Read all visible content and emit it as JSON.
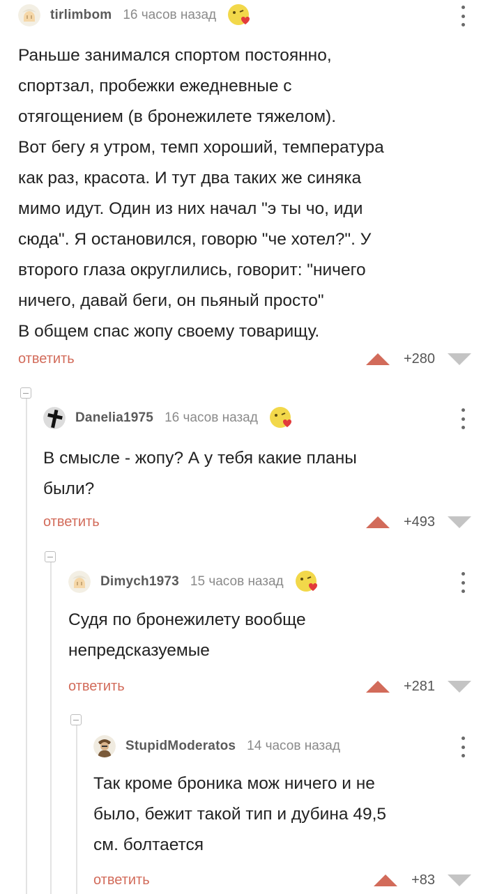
{
  "comments": [
    {
      "author": "tirlimbom",
      "time": "16 часов назад",
      "text": "Раньше занимался спортом постоянно,\nспортзал, пробежки ежедневные с\nотягощением (в бронежилете тяжелом).\nВот бегу я утром, темп хороший, температура\nкак раз, красота. И тут два таких же синяка\nмимо идут. Один из них начал \"э ты чо, иди\nсюда\". Я остановился, говорю \"че хотел?\". У\nвторого глаза округлились, говорит: \"ничего\nничего, давай беги, он пьяный просто\"\nВ общем спас жопу своему товарищу.",
      "reply": "ответить",
      "rating": "+280"
    },
    {
      "author": "Danelia1975",
      "time": "16 часов назад",
      "text": "В смысле - жопу? А у тебя какие планы\nбыли?",
      "reply": "ответить",
      "rating": "+493"
    },
    {
      "author": "Dimych1973",
      "time": "15 часов назад",
      "text": "Судя по бронежилету вообще\nнепредсказуемые",
      "reply": "ответить",
      "rating": "+281"
    },
    {
      "author": "StupidModeratos",
      "time": "14 часов назад",
      "text": "Так кроме броника мож ничего и не\nбыло, бежит такой тип и дубина 49,5\nсм. болтается",
      "reply": "ответить",
      "rating": "+83"
    }
  ],
  "colors": {
    "accent": "#d26b5a",
    "vote_down": "#c4c4c4",
    "branch_line": "#e3e3e3"
  },
  "icons": [
    "avatar-placeholder-icon",
    "cross-avatar-icon",
    "person-avatar-icon",
    "emoji-heart-badge-icon",
    "more-vertical-icon",
    "upvote-icon",
    "downvote-icon",
    "collapse-icon"
  ]
}
